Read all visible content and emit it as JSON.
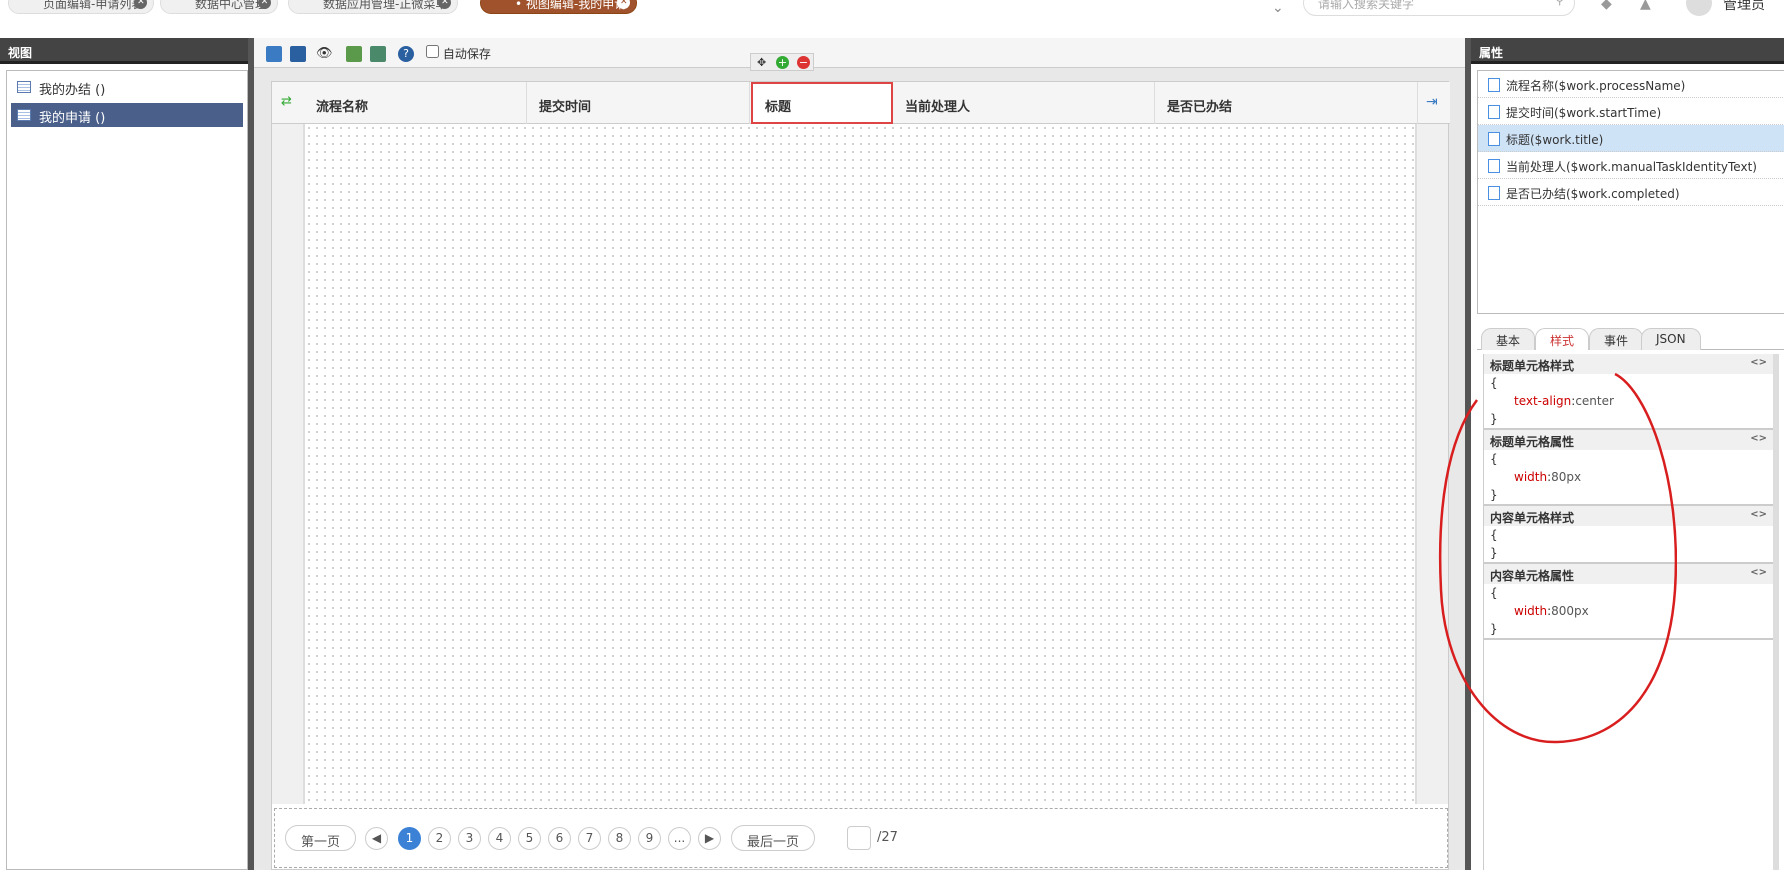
{
  "topbar": {
    "tabs": [
      {
        "label": "页面编辑-申请列表"
      },
      {
        "label": "数据中心管理"
      },
      {
        "label": "数据应用管理-正微菜单"
      },
      {
        "label": "• 视图编辑-我的申请"
      }
    ],
    "search_placeholder": "请输入搜索关键字",
    "user": "管理员"
  },
  "left_panel": {
    "title": "视图",
    "items": [
      {
        "label": "我的办结 ()"
      },
      {
        "label": "我的申请 ()"
      }
    ]
  },
  "toolbar": {
    "autosave_label": "自动保存"
  },
  "table": {
    "headers": [
      "流程名称",
      "提交时间",
      "标题",
      "当前处理人",
      "是否已办结"
    ]
  },
  "pager": {
    "first": "第一页",
    "pages": [
      "1",
      "2",
      "3",
      "4",
      "5",
      "6",
      "7",
      "8",
      "9",
      "..."
    ],
    "last": "最后一页",
    "total": "/27"
  },
  "right_panel": {
    "title": "属性",
    "props": [
      {
        "label": "流程名称($work.processName)"
      },
      {
        "label": "提交时间($work.startTime)"
      },
      {
        "label": "标题($work.title)"
      },
      {
        "label": "当前处理人($work.manualTaskIdentityText)"
      },
      {
        "label": "是否已办结($work.completed)"
      }
    ],
    "tabs": [
      "基本",
      "样式",
      "事件",
      "JSON"
    ],
    "sections": [
      {
        "title": "标题单元格样式",
        "open": "{",
        "prop": "text-align",
        "sep": ":",
        "val": "center",
        "close": "}"
      },
      {
        "title": "标题单元格属性",
        "open": "{",
        "prop": "width",
        "sep": ":",
        "val": "80px",
        "close": "}"
      },
      {
        "title": "内容单元格样式",
        "open": "{",
        "close": "}"
      },
      {
        "title": "内容单元格属性",
        "open": "{",
        "prop": "width",
        "sep": ":",
        "val": "800px",
        "close": "}"
      }
    ],
    "code_toggle": "<>"
  }
}
